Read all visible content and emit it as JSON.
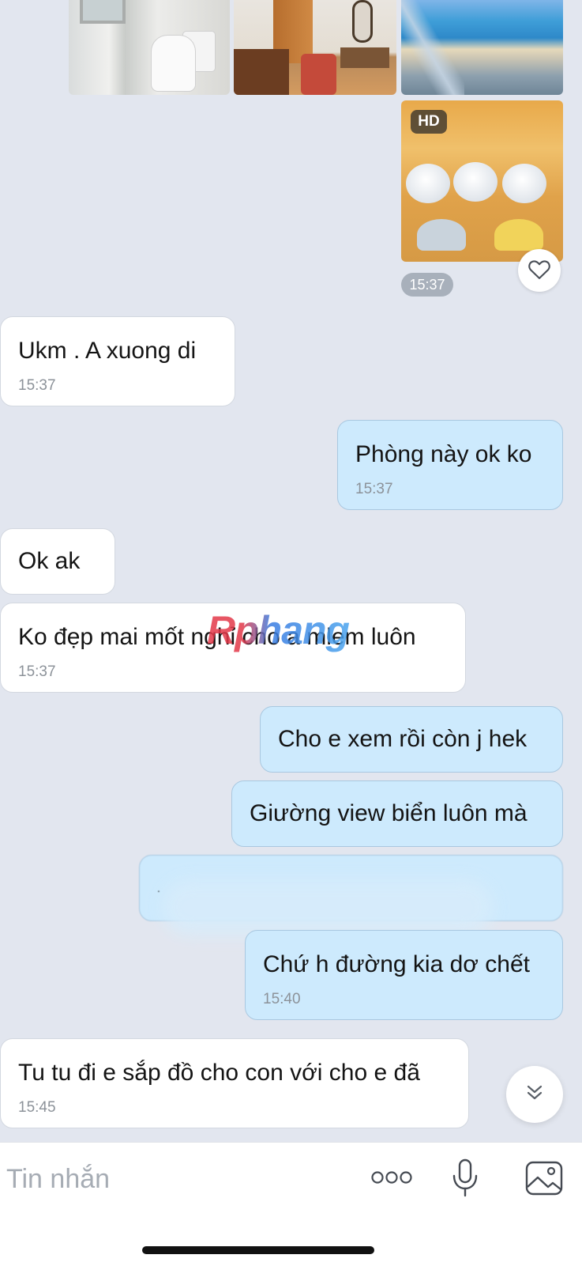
{
  "gallery": {
    "hd_badge": "HD",
    "sent_time": "15:37"
  },
  "messages": [
    {
      "id": "m1",
      "side": "in",
      "text": "Ukm . A xuong di",
      "time": "15:37"
    },
    {
      "id": "m2",
      "side": "out",
      "text": "Phòng này ok ko",
      "time": "15:37"
    },
    {
      "id": "m3",
      "side": "in",
      "text": "Ok ak",
      "time": ""
    },
    {
      "id": "m4",
      "side": "in",
      "text": "Ko đẹp mai mốt nghỉ cho a mlem luôn",
      "time": "15:37"
    },
    {
      "id": "m5",
      "side": "out",
      "text": "Cho e xem rồi còn j hek",
      "time": ""
    },
    {
      "id": "m6",
      "side": "out",
      "text": "Giường view biển luôn mà",
      "time": ""
    },
    {
      "id": "m7",
      "side": "out",
      "text": ".",
      "time": ""
    },
    {
      "id": "m8",
      "side": "out",
      "text": "Chứ h đường kia dơ chết",
      "time": "15:40"
    },
    {
      "id": "m9",
      "side": "in",
      "text": "Tu tu đi e sắp đồ cho con với cho e đã",
      "time": "15:45"
    }
  ],
  "watermark": "Rphang",
  "composer": {
    "placeholder": "Tin nhắn"
  },
  "icons": {
    "heart": "heart-icon",
    "scroll": "double-chevron-down-icon",
    "more": "more-dots-icon",
    "mic": "microphone-icon",
    "gallery": "image-gallery-icon"
  },
  "colors": {
    "background": "#e2e6ef",
    "incoming_bubble": "#ffffff",
    "outgoing_bubble": "#cdeafd",
    "timestamp": "#8c9299"
  }
}
